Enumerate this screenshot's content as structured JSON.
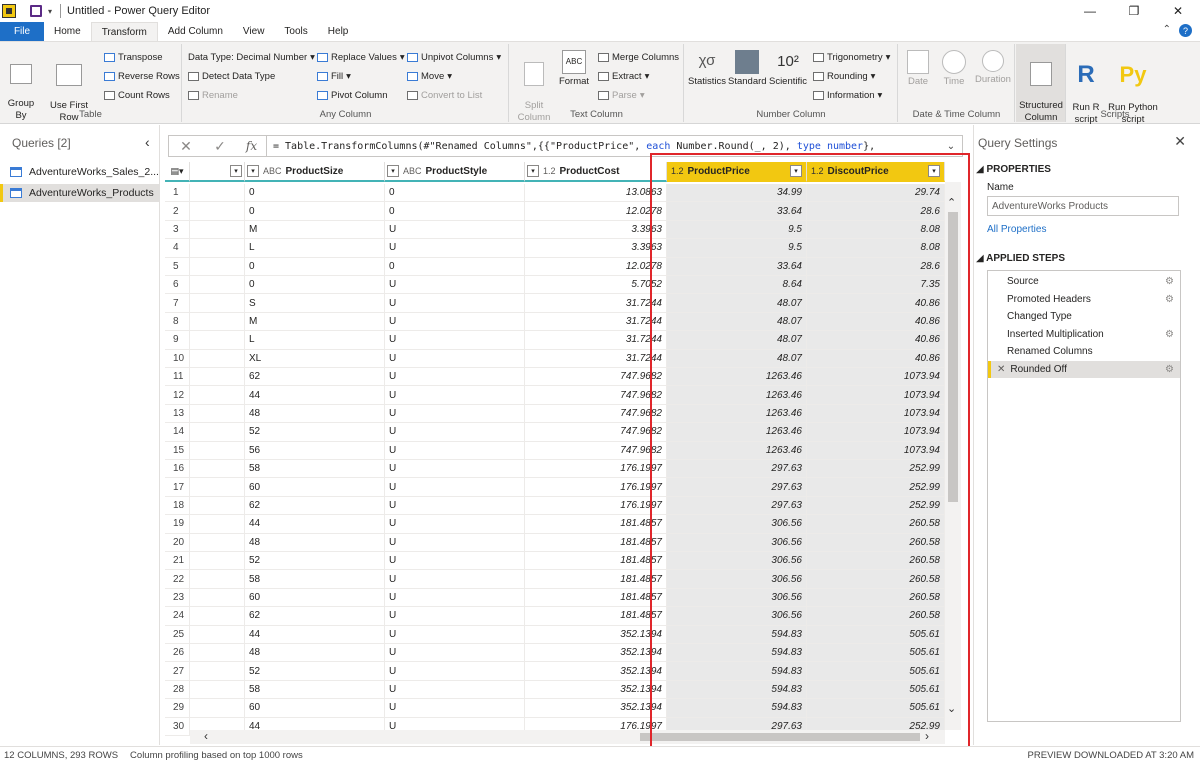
{
  "window": {
    "title": "Untitled - Power Query Editor"
  },
  "tabs": [
    {
      "label": "File"
    },
    {
      "label": "Home"
    },
    {
      "label": "Transform"
    },
    {
      "label": "Add Column"
    },
    {
      "label": "View"
    },
    {
      "label": "Tools"
    },
    {
      "label": "Help"
    }
  ],
  "ribbon": {
    "table": {
      "label": "Table",
      "group_by": "Group\nBy",
      "use_first_row": "Use First Row\nas Headers",
      "transpose": "Transpose",
      "reverse_rows": "Reverse Rows",
      "count_rows": "Count Rows"
    },
    "any_column": {
      "label": "Any Column",
      "data_type": "Data Type: Decimal Number",
      "detect_data_type": "Detect Data Type",
      "rename": "Rename",
      "replace_values": "Replace Values",
      "fill": "Fill",
      "pivot_column": "Pivot Column",
      "unpivot_columns": "Unpivot Columns",
      "move": "Move",
      "convert_to_list": "Convert to List"
    },
    "text_column": {
      "label": "Text Column",
      "split_column": "Split\nColumn",
      "format": "Format",
      "merge_columns": "Merge Columns",
      "extract": "Extract",
      "parse": "Parse"
    },
    "number_column": {
      "label": "Number Column",
      "statistics": "Statistics",
      "standard": "Standard",
      "scientific": "Scientific",
      "trigonometry": "Trigonometry",
      "rounding": "Rounding",
      "information": "Information"
    },
    "date_time_column": {
      "label": "Date & Time Column",
      "date": "Date",
      "time": "Time",
      "duration": "Duration"
    },
    "structured": {
      "label": "Structured\nColumn"
    },
    "scripts": {
      "label": "Scripts",
      "run_r": "Run R\nscript",
      "run_python": "Run Python\nscript"
    }
  },
  "queries": {
    "title": "Queries [2]",
    "items": [
      {
        "label": "AdventureWorks_Sales_2..."
      },
      {
        "label": "AdventureWorks_Products"
      }
    ]
  },
  "formula": {
    "prefix": "= Table.TransformColumns(#\"Renamed Columns\",{{\"ProductPrice\", ",
    "kw1": "each",
    "mid": " Number.Round(_, 2), ",
    "kw2": "type",
    "space": " ",
    "kw3": "number",
    "suffix": "},"
  },
  "grid": {
    "columns": [
      {
        "name": "",
        "type": ""
      },
      {
        "name": "ProductSize",
        "type": "ABC"
      },
      {
        "name": "ProductStyle",
        "type": "ABC"
      },
      {
        "name": "ProductCost",
        "type": "1.2"
      },
      {
        "name": "ProductPrice",
        "type": "1.2"
      },
      {
        "name": "DiscoutPrice",
        "type": "1.2"
      }
    ],
    "rows": [
      [
        "1",
        "",
        "0",
        "0",
        "13.0863",
        "34.99",
        "29.74"
      ],
      [
        "2",
        "",
        "0",
        "0",
        "12.0278",
        "33.64",
        "28.6"
      ],
      [
        "3",
        "",
        "M",
        "U",
        "3.3963",
        "9.5",
        "8.08"
      ],
      [
        "4",
        "",
        "L",
        "U",
        "3.3963",
        "9.5",
        "8.08"
      ],
      [
        "5",
        "",
        "0",
        "0",
        "12.0278",
        "33.64",
        "28.6"
      ],
      [
        "6",
        "",
        "0",
        "U",
        "5.7052",
        "8.64",
        "7.35"
      ],
      [
        "7",
        "",
        "S",
        "U",
        "31.7244",
        "48.07",
        "40.86"
      ],
      [
        "8",
        "",
        "M",
        "U",
        "31.7244",
        "48.07",
        "40.86"
      ],
      [
        "9",
        "",
        "L",
        "U",
        "31.7244",
        "48.07",
        "40.86"
      ],
      [
        "10",
        "",
        "XL",
        "U",
        "31.7244",
        "48.07",
        "40.86"
      ],
      [
        "11",
        "",
        "62",
        "U",
        "747.9682",
        "1263.46",
        "1073.94"
      ],
      [
        "12",
        "",
        "44",
        "U",
        "747.9682",
        "1263.46",
        "1073.94"
      ],
      [
        "13",
        "",
        "48",
        "U",
        "747.9682",
        "1263.46",
        "1073.94"
      ],
      [
        "14",
        "",
        "52",
        "U",
        "747.9682",
        "1263.46",
        "1073.94"
      ],
      [
        "15",
        "",
        "56",
        "U",
        "747.9682",
        "1263.46",
        "1073.94"
      ],
      [
        "16",
        "",
        "58",
        "U",
        "176.1997",
        "297.63",
        "252.99"
      ],
      [
        "17",
        "",
        "60",
        "U",
        "176.1997",
        "297.63",
        "252.99"
      ],
      [
        "18",
        "",
        "62",
        "U",
        "176.1997",
        "297.63",
        "252.99"
      ],
      [
        "19",
        "",
        "44",
        "U",
        "181.4857",
        "306.56",
        "260.58"
      ],
      [
        "20",
        "",
        "48",
        "U",
        "181.4857",
        "306.56",
        "260.58"
      ],
      [
        "21",
        "",
        "52",
        "U",
        "181.4857",
        "306.56",
        "260.58"
      ],
      [
        "22",
        "",
        "58",
        "U",
        "181.4857",
        "306.56",
        "260.58"
      ],
      [
        "23",
        "",
        "60",
        "U",
        "181.4857",
        "306.56",
        "260.58"
      ],
      [
        "24",
        "",
        "62",
        "U",
        "181.4857",
        "306.56",
        "260.58"
      ],
      [
        "25",
        "",
        "44",
        "U",
        "352.1394",
        "594.83",
        "505.61"
      ],
      [
        "26",
        "",
        "48",
        "U",
        "352.1394",
        "594.83",
        "505.61"
      ],
      [
        "27",
        "",
        "52",
        "U",
        "352.1394",
        "594.83",
        "505.61"
      ],
      [
        "28",
        "",
        "58",
        "U",
        "352.1394",
        "594.83",
        "505.61"
      ],
      [
        "29",
        "",
        "60",
        "U",
        "352.1394",
        "594.83",
        "505.61"
      ],
      [
        "30",
        "",
        "44",
        "U",
        "176.1997",
        "297.63",
        "252.99"
      ]
    ]
  },
  "settings": {
    "title": "Query Settings",
    "properties": "PROPERTIES",
    "name_label": "Name",
    "name_value": "AdventureWorks Products",
    "all_properties": "All Properties",
    "applied_steps": "APPLIED STEPS",
    "steps": [
      {
        "label": "Source",
        "gear": true
      },
      {
        "label": "Promoted Headers",
        "gear": true
      },
      {
        "label": "Changed Type",
        "gear": false
      },
      {
        "label": "Inserted Multiplication",
        "gear": true
      },
      {
        "label": "Renamed Columns",
        "gear": false
      },
      {
        "label": "Rounded Off",
        "gear": true
      }
    ]
  },
  "status": {
    "columns_rows": "12 COLUMNS, 293 ROWS",
    "profiling": "Column profiling based on top 1000 rows",
    "preview": "PREVIEW DOWNLOADED AT 3:20 AM"
  },
  "colors": {
    "accent": "#f2c811",
    "file_tab": "#1e6fc7",
    "highlight_box": "#e0262b",
    "header_underline": "#43b3b6"
  }
}
